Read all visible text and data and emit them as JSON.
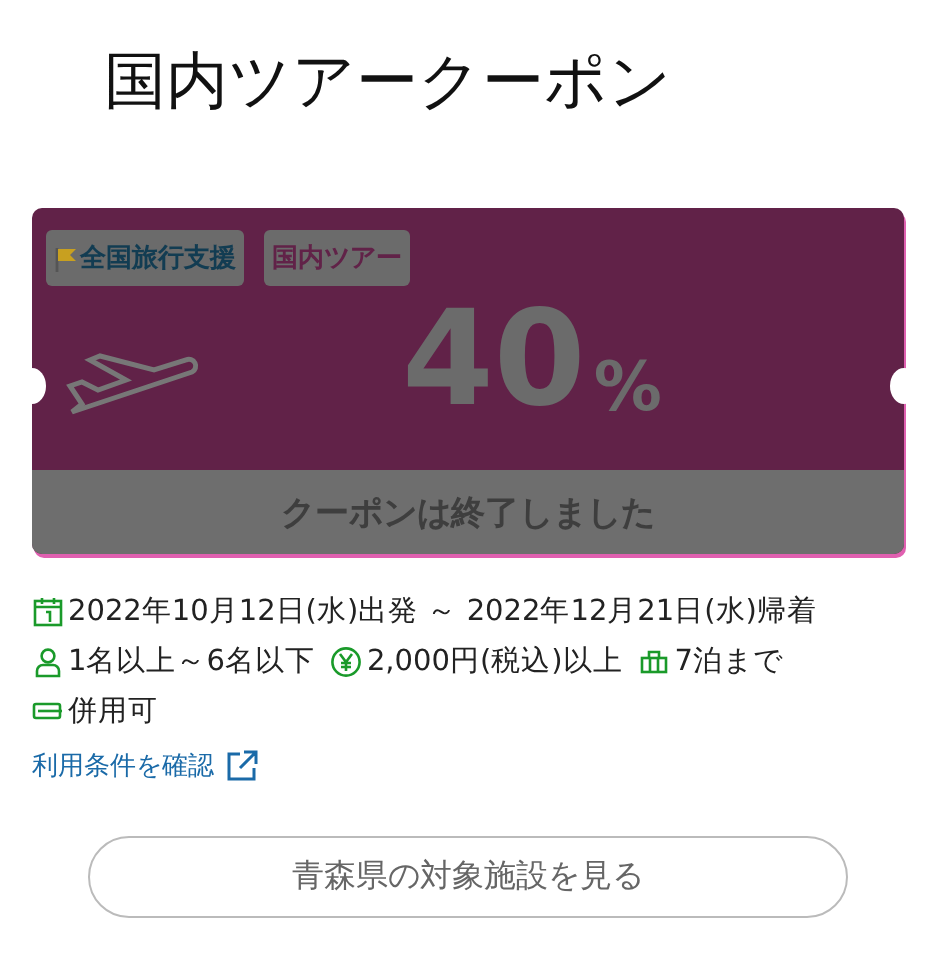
{
  "title": "国内ツアークーポン",
  "coupon": {
    "tags": [
      {
        "label": "全国旅行支援",
        "kind": "flag"
      },
      {
        "label": "国内ツアー",
        "kind": "plain"
      }
    ],
    "discount": "40",
    "unit": "%",
    "expired": true,
    "status_text": "クーポンは終了しました"
  },
  "conditions": [
    {
      "items": [
        {
          "kind": "calendar",
          "text": "2022年10月12日(水)出発 ～ 2022年12月21日(水)帰着"
        }
      ]
    },
    {
      "items": [
        {
          "kind": "person",
          "text": "1名以上～6名以下"
        },
        {
          "kind": "yen",
          "text": "2,000円(税込)以上"
        },
        {
          "kind": "bag",
          "text": "7泊まで"
        }
      ]
    },
    {
      "items": [
        {
          "kind": "ticket",
          "text": "併用可"
        }
      ]
    }
  ],
  "terms_link": "利用条件を確認",
  "button": "青森県の対象施設を見る"
}
